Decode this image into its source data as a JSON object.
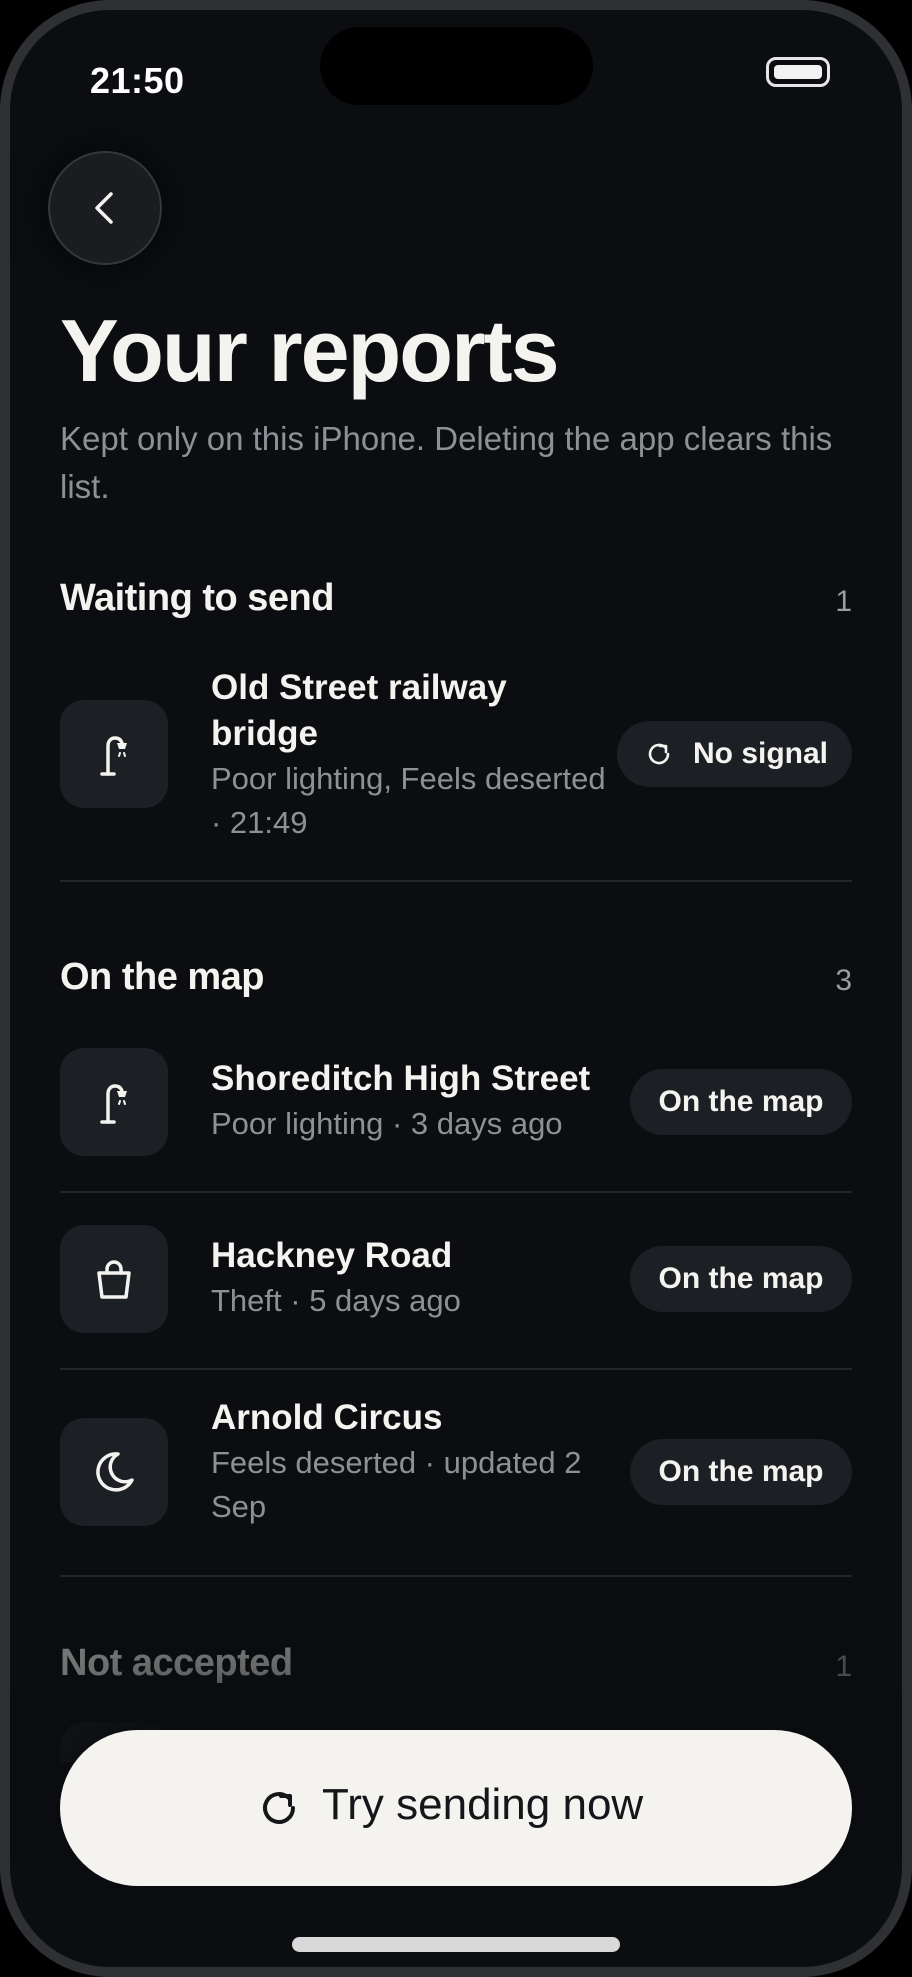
{
  "status_bar": {
    "time": "21:50"
  },
  "header": {
    "title": "Your reports",
    "subtitle": "Kept only on this iPhone. Deleting the app clears this list."
  },
  "sections": {
    "waiting": {
      "title": "Waiting to send",
      "count": "1",
      "items": [
        {
          "title": "Old Street railway bridge",
          "meta": "Poor lighting, Feels deserted · 21:49",
          "icon": "streetlamp-icon",
          "status": "No signal"
        }
      ]
    },
    "on_map": {
      "title": "On the map",
      "count": "3",
      "items": [
        {
          "title": "Shoreditch High Street",
          "meta": "Poor lighting · 3 days ago",
          "icon": "streetlamp-icon",
          "status": "On the map"
        },
        {
          "title": "Hackney Road",
          "meta": "Theft · 5 days ago",
          "icon": "bag-icon",
          "status": "On the map"
        },
        {
          "title": "Arnold Circus",
          "meta": "Feels deserted · updated 2 Sep",
          "icon": "moon-icon",
          "status": "On the map"
        }
      ]
    },
    "not_accepted": {
      "title": "Not accepted",
      "count": "1"
    }
  },
  "cta": {
    "label": "Try sending now",
    "icon": "refresh-icon"
  },
  "colors": {
    "background": "#0b0d10",
    "surface": "#1c1f24",
    "text": "#f4f3ef",
    "muted": "#8e9096",
    "cta_background": "#f4f3ef"
  }
}
